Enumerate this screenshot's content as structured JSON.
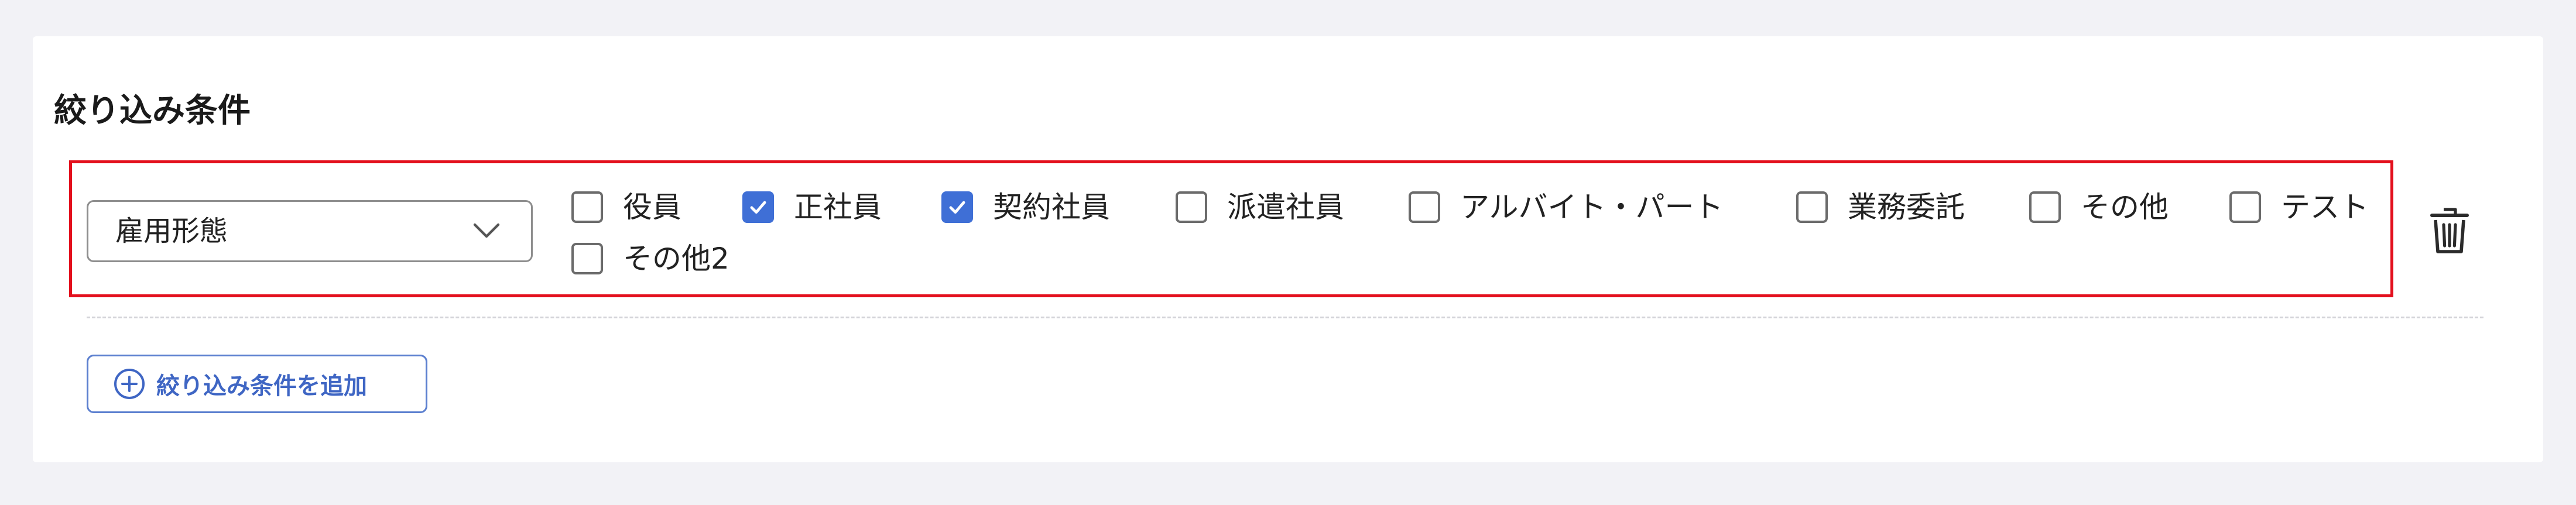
{
  "section": {
    "title": "絞り込み条件"
  },
  "filter": {
    "select_value": "雇用形態",
    "options": [
      {
        "label": "役員",
        "checked": false
      },
      {
        "label": "正社員",
        "checked": true
      },
      {
        "label": "契約社員",
        "checked": true
      },
      {
        "label": "派遣社員",
        "checked": false
      },
      {
        "label": "アルバイト・パート",
        "checked": false
      },
      {
        "label": "業務委託",
        "checked": false
      },
      {
        "label": "その他",
        "checked": false
      },
      {
        "label": "テスト",
        "checked": false
      },
      {
        "label": "その他2",
        "checked": false
      }
    ]
  },
  "actions": {
    "add_label": "絞り込み条件を追加"
  },
  "icons": {
    "dropdown": "chevron-down-icon",
    "delete": "trash-icon",
    "add": "plus-circle-icon",
    "check": "check-icon"
  },
  "colors": {
    "accent": "#3f6fd6",
    "highlight_border": "#e3101d",
    "link": "#3f66c4"
  }
}
